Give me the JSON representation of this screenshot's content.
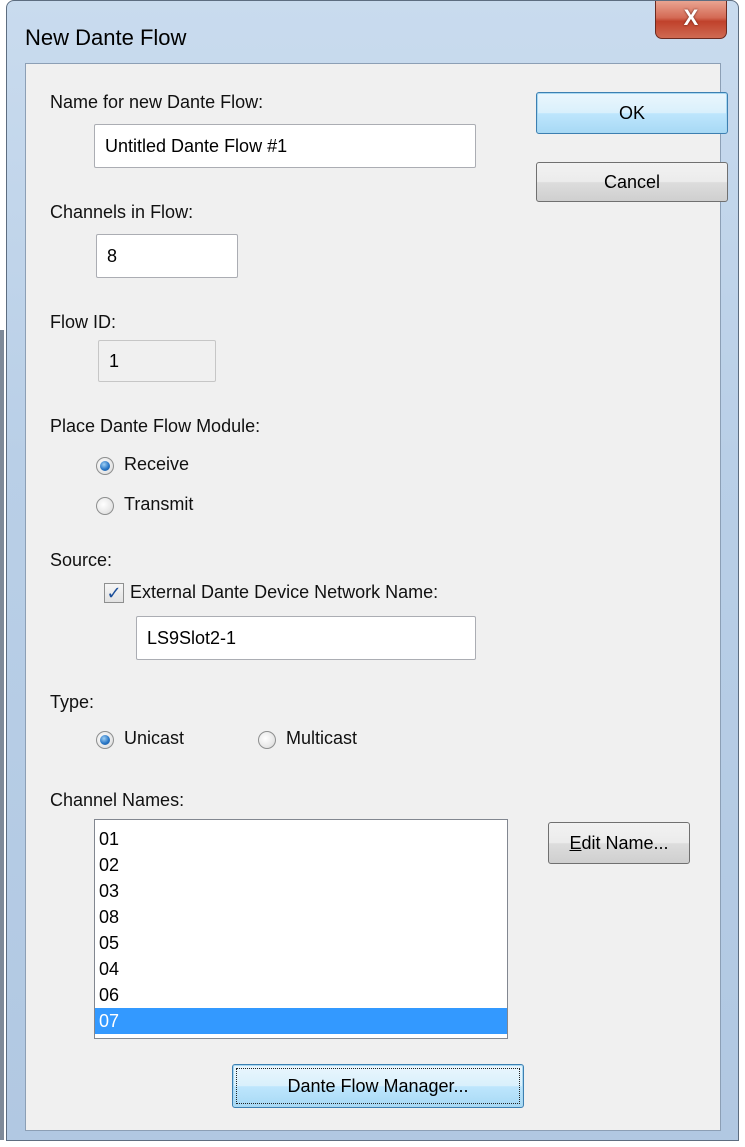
{
  "window": {
    "title": "New Dante Flow",
    "close_glyph": "X"
  },
  "form": {
    "name_label": "Name for new Dante Flow:",
    "name_value": "Untitled Dante Flow #1",
    "channels_label": "Channels in Flow:",
    "channels_value": "8",
    "flow_id_label": "Flow ID:",
    "flow_id_value": "1",
    "place_label": "Place Dante Flow Module:",
    "place_options": [
      {
        "label": "Receive",
        "selected": true
      },
      {
        "label": "Transmit",
        "selected": false
      }
    ],
    "source_label": "Source:",
    "external_checkbox_label": "External Dante Device Network Name:",
    "external_checked": true,
    "external_name_value": "LS9Slot2-1",
    "type_label": "Type:",
    "type_options": [
      {
        "label": "Unicast",
        "selected": true
      },
      {
        "label": "Multicast",
        "selected": false
      }
    ],
    "channel_names_label": "Channel Names:",
    "channel_names": [
      "01",
      "02",
      "03",
      "08",
      "05",
      "04",
      "06",
      "07"
    ],
    "selected_channel_index": 7
  },
  "buttons": {
    "ok": "OK",
    "cancel": "Cancel",
    "edit_name_accel": "E",
    "edit_name_rest": "dit Name...",
    "flow_manager": "Dante Flow Manager..."
  },
  "colors": {
    "selection": "#3399ff",
    "dialog_bg": "#f0f0f0",
    "title_bar": "#b9cfe7",
    "close_button": "#c0412b"
  },
  "icons": {
    "close": "close-icon",
    "checkmark": "checkmark-icon"
  }
}
